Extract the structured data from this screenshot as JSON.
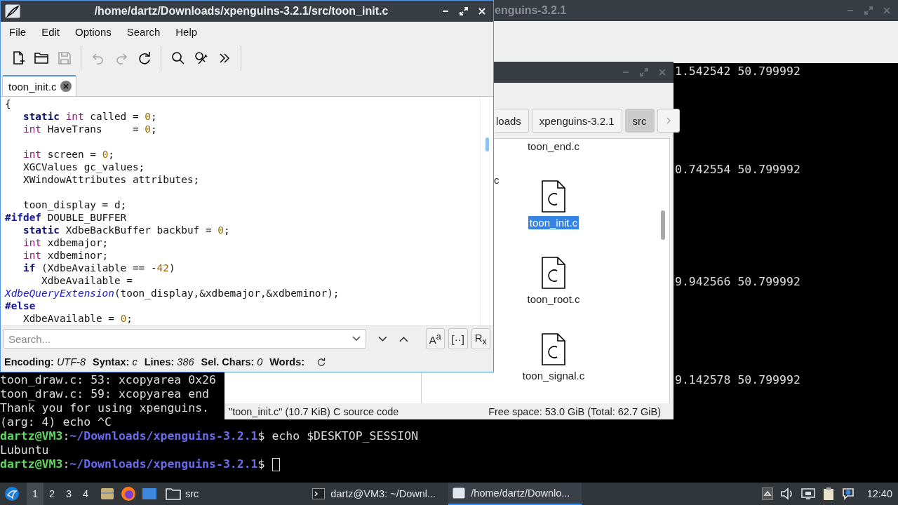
{
  "terminal": {
    "title": "enguins-3.2.1",
    "readouts": [
      "1.542542 50.799992",
      "0.742554 50.799992",
      "9.942566 50.799992",
      "9.142578 50.799992"
    ],
    "lines": [
      {
        "kind": "output",
        "text": "toon_draw.c: 53: xcopyarea 0x26"
      },
      {
        "kind": "output",
        "text": "toon_draw.c: 59: xcopyarea end"
      },
      {
        "kind": "output",
        "text": "Thank you for using xpenguins."
      },
      {
        "kind": "output",
        "text": "(arg: 4) echo ^C"
      },
      {
        "kind": "prompt",
        "user": "dartz@VM3",
        "sep": ":",
        "path": "~/Downloads/xpenguins-3.2.1",
        "symbol": "$",
        "command": "echo $DESKTOP_SESSION",
        "cursor": false
      },
      {
        "kind": "output",
        "text": "Lubuntu"
      },
      {
        "kind": "prompt",
        "user": "dartz@VM3",
        "sep": ":",
        "path": "~/Downloads/xpenguins-3.2.1",
        "symbol": "$",
        "cursor": true
      }
    ]
  },
  "file_manager": {
    "path": [
      {
        "label": "loads",
        "selected": false
      },
      {
        "label": "xpenguins-3.2.1",
        "selected": false
      },
      {
        "label": "src",
        "selected": true
      }
    ],
    "files": [
      {
        "name": "toon_end.c",
        "selected": false
      },
      {
        "name": "toon_init.c",
        "selected": true
      },
      {
        "name": "toon_root.c",
        "selected": false
      },
      {
        "name": "toon_signal.c",
        "selected": false
      }
    ],
    "fragments": [
      "c"
    ],
    "status_left": "\"toon_init.c\" (10.7 KiB) C source code",
    "status_right": "Free space: 53.0 GiB (Total: 62.7 GiB)"
  },
  "editor": {
    "title": "/home/dartz/Downloads/xpenguins-3.2.1/src/toon_init.c",
    "menu": [
      "File",
      "Edit",
      "Options",
      "Search",
      "Help"
    ],
    "toolbar": [
      [
        {
          "kind": "new",
          "disabled": false
        },
        {
          "kind": "open",
          "disabled": false
        },
        {
          "kind": "save",
          "disabled": true
        }
      ],
      [
        {
          "kind": "undo",
          "disabled": true
        },
        {
          "kind": "redo",
          "disabled": true
        },
        {
          "kind": "reload",
          "disabled": false
        }
      ],
      [
        {
          "kind": "find",
          "disabled": false
        },
        {
          "kind": "replace",
          "disabled": false
        },
        {
          "kind": "more",
          "disabled": false
        }
      ]
    ],
    "tabs": [
      {
        "label": "toon_init.c",
        "selected": true
      }
    ],
    "code": [
      {
        "kind": "code",
        "tokens": [
          {
            "s": "{",
            "kind": "plain"
          }
        ]
      },
      {
        "kind": "code",
        "tokens": [
          {
            "s": "   static",
            "kind": "keyword"
          },
          {
            "s": " int",
            "kind": "type"
          },
          {
            "s": " called = ",
            "kind": "plain"
          },
          {
            "s": "0",
            "kind": "number"
          },
          {
            "s": ";",
            "kind": "plain"
          }
        ]
      },
      {
        "kind": "code",
        "tokens": [
          {
            "s": "   int",
            "kind": "type"
          },
          {
            "s": " HaveTrans     = ",
            "kind": "plain"
          },
          {
            "s": "0",
            "kind": "number"
          },
          {
            "s": ";",
            "kind": "plain"
          }
        ]
      },
      {
        "kind": "blank"
      },
      {
        "kind": "code",
        "tokens": [
          {
            "s": "   int",
            "kind": "type"
          },
          {
            "s": " screen = ",
            "kind": "plain"
          },
          {
            "s": "0",
            "kind": "number"
          },
          {
            "s": ";",
            "kind": "plain"
          }
        ]
      },
      {
        "kind": "code",
        "tokens": [
          {
            "s": "   XGCValues gc_values;",
            "kind": "plain"
          }
        ]
      },
      {
        "kind": "code",
        "tokens": [
          {
            "s": "   XWindowAttributes attributes;",
            "kind": "plain"
          }
        ]
      },
      {
        "kind": "blank"
      },
      {
        "kind": "code",
        "tokens": [
          {
            "s": "   toon_display = d;",
            "kind": "plain"
          }
        ]
      },
      {
        "kind": "code",
        "tokens": [
          {
            "s": "#ifdef",
            "kind": "preprocessor"
          },
          {
            "s": " DOUBLE_BUFFER",
            "kind": "plain"
          }
        ]
      },
      {
        "kind": "code",
        "tokens": [
          {
            "s": "   static",
            "kind": "keyword"
          },
          {
            "s": " XdbeBackBuffer backbuf = ",
            "kind": "plain"
          },
          {
            "s": "0",
            "kind": "number"
          },
          {
            "s": ";",
            "kind": "plain"
          }
        ]
      },
      {
        "kind": "code",
        "tokens": [
          {
            "s": "   int",
            "kind": "type"
          },
          {
            "s": " xdbemajor;",
            "kind": "plain"
          }
        ]
      },
      {
        "kind": "code",
        "tokens": [
          {
            "s": "   int",
            "kind": "type"
          },
          {
            "s": " xdbeminor;",
            "kind": "plain"
          }
        ]
      },
      {
        "kind": "code",
        "tokens": [
          {
            "s": "   if",
            "kind": "keyword"
          },
          {
            "s": " (XdbeAvailable == -",
            "kind": "plain"
          },
          {
            "s": "42",
            "kind": "number"
          },
          {
            "s": ")",
            "kind": "plain"
          }
        ]
      },
      {
        "kind": "code",
        "tokens": [
          {
            "s": "      XdbeAvailable =",
            "kind": "plain"
          }
        ]
      },
      {
        "kind": "code",
        "tokens": [
          {
            "s": "XdbeQueryExtension",
            "kind": "function"
          },
          {
            "s": "(toon_display,&xdbemajor,&xdbeminor);",
            "kind": "plain"
          }
        ]
      },
      {
        "kind": "code",
        "tokens": [
          {
            "s": "#else",
            "kind": "preprocessor"
          }
        ]
      },
      {
        "kind": "code",
        "tokens": [
          {
            "s": "   XdbeAvailable = ",
            "kind": "plain"
          },
          {
            "s": "0",
            "kind": "number"
          },
          {
            "s": ";",
            "kind": "plain"
          }
        ]
      }
    ],
    "search": {
      "placeholder": "Search...",
      "options": [
        "A$^{a}$",
        "[··]",
        "R$_{x}$"
      ]
    },
    "status": [
      {
        "label": "Encoding:",
        "value": "UTF-8"
      },
      {
        "label": "Syntax:",
        "value": "c"
      },
      {
        "label": "Lines:",
        "value": "386"
      },
      {
        "label": "Sel. Chars:",
        "value": "0"
      },
      {
        "label": "Words:"
      }
    ]
  },
  "taskbar": {
    "workspaces": [
      {
        "label": "1",
        "selected": true
      },
      {
        "label": "2",
        "selected": false
      },
      {
        "label": "3",
        "selected": false
      },
      {
        "label": "4",
        "selected": false
      }
    ],
    "launchers": [
      {
        "kind": "files"
      },
      {
        "kind": "browser"
      },
      {
        "kind": "desktop"
      }
    ],
    "folder": {
      "label": "src"
    },
    "tasks": [
      {
        "kind": "terminal",
        "label": "dartz@VM3: ~/Downl...",
        "selected": false
      },
      {
        "kind": "editor",
        "label": "/home/dartz/Downlo...",
        "selected": true
      }
    ],
    "tray": [
      {
        "kind": "arrow"
      },
      {
        "kind": "volume"
      },
      {
        "kind": "network"
      },
      {
        "kind": "clipboard"
      },
      {
        "kind": "notify"
      }
    ],
    "clock": "12:40"
  }
}
